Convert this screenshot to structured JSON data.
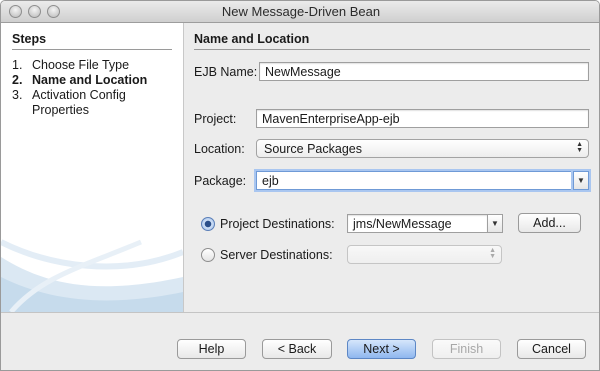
{
  "window": {
    "title": "New Message-Driven Bean"
  },
  "steps": {
    "heading": "Steps",
    "items": [
      {
        "num": "1.",
        "label": "Choose File Type"
      },
      {
        "num": "2.",
        "label": "Name and Location"
      },
      {
        "num": "3.",
        "label": "Activation Config"
      },
      {
        "num": "",
        "label": "Properties"
      }
    ]
  },
  "form": {
    "heading": "Name and Location",
    "ejb_name_label": "EJB Name:",
    "ejb_name_value": "NewMessage",
    "project_label": "Project:",
    "project_value": "MavenEnterpriseApp-ejb",
    "location_label": "Location:",
    "location_value": "Source Packages",
    "package_label": "Package:",
    "package_value": "ejb",
    "project_dest_label": "Project Destinations:",
    "project_dest_value": "jms/NewMessage",
    "server_dest_label": "Server Destinations:",
    "server_dest_value": "",
    "add_label": "Add..."
  },
  "footer": {
    "help": "Help",
    "back": "< Back",
    "next": "Next >",
    "finish": "Finish",
    "cancel": "Cancel"
  }
}
